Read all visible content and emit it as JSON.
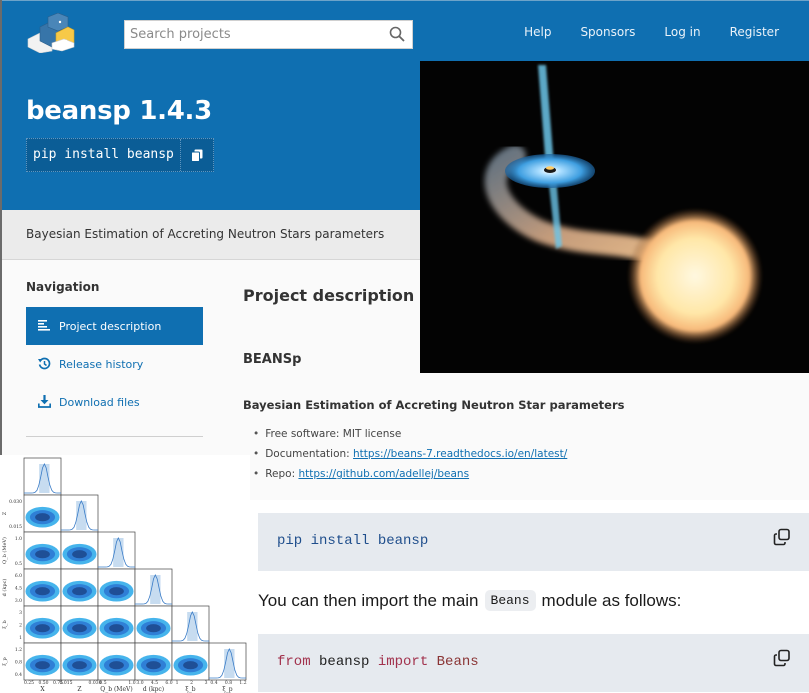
{
  "header": {
    "logo_name": "PyPI",
    "search_placeholder": "Search projects",
    "nav": [
      {
        "label": "Help"
      },
      {
        "label": "Sponsors"
      },
      {
        "label": "Log in"
      },
      {
        "label": "Register"
      }
    ]
  },
  "package": {
    "title": "beansp 1.4.3",
    "pip_command": "pip install beansp",
    "summary": "Bayesian Estimation of Accreting Neutron Stars parameters"
  },
  "sidebar": {
    "heading": "Navigation",
    "items": [
      {
        "label": "Project description",
        "icon": "align-left-icon",
        "active": true
      },
      {
        "label": "Release history",
        "icon": "history-icon",
        "active": false
      },
      {
        "label": "Download files",
        "icon": "download-icon",
        "active": false
      }
    ]
  },
  "description": {
    "heading": "Project description",
    "title": "BEANSp",
    "subtitle": "Bayesian Estimation of Accreting Neutron Star parameters",
    "bullets": [
      {
        "prefix": "Free software: MIT license",
        "link": ""
      },
      {
        "prefix": "Documentation: ",
        "link": "https://beans-7.readthedocs.io/en/latest/"
      },
      {
        "prefix": "Repo: ",
        "link": "https://github.com/adellej/beans"
      }
    ]
  },
  "readme": {
    "code1": "pip install beansp",
    "para_before": "You can then import the main",
    "para_code": "Beans",
    "para_after": "module as follows:",
    "code2": {
      "kw1": "from",
      "mod": " beansp ",
      "kw2": "import",
      "cls": " Beans"
    }
  },
  "corner_plot": {
    "parameters": [
      "X",
      "Z",
      "Q_b (MeV)",
      "d (kpc)",
      "ξ_b",
      "ξ_p"
    ],
    "x_ticks": [
      [
        "0.25",
        "0.50",
        "0.75"
      ],
      [
        "0.015",
        "0.030"
      ],
      [
        "0.5",
        "1.0"
      ],
      [
        "3.0",
        "4.5",
        "6.0"
      ],
      [
        "1",
        "2",
        "3"
      ],
      [
        "0.4",
        "0.8",
        "1.2"
      ]
    ],
    "y_labels": [
      "Z",
      "Q_b (MeV)",
      "d (kpc)",
      "ξ_b",
      "ξ_p"
    ],
    "y_ticks": [
      [
        "0.030",
        "0.015"
      ],
      [
        "1.0",
        "0.5"
      ],
      [
        "6.0",
        "4.5",
        "3.0"
      ],
      [
        "3",
        "2",
        "1"
      ],
      [
        "1.2",
        "0.8",
        "0.4"
      ]
    ]
  },
  "colors": {
    "brand_blue": "#0f6fb1",
    "summary_band": "#ebebeb",
    "code_bg": "#e6eaef",
    "contour_dark": "#1f4f96",
    "contour_mid": "#2f7fd6",
    "contour_light": "#46b4ec"
  }
}
